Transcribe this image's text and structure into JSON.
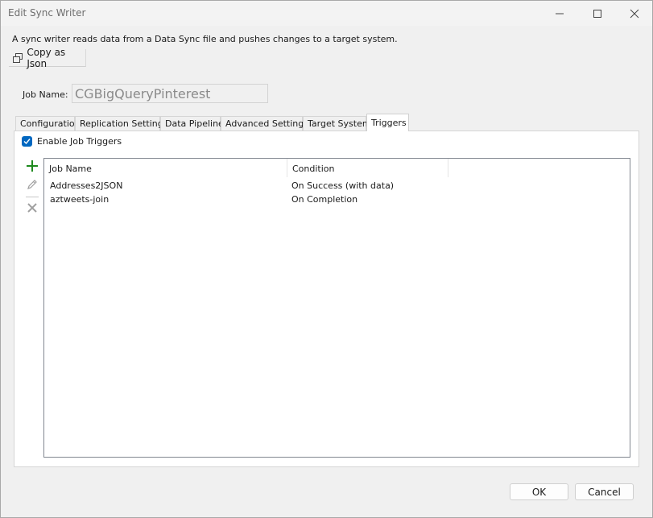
{
  "window": {
    "title": "Edit Sync Writer"
  },
  "description": "A sync writer reads data from a Data Sync file and pushes changes to a target system.",
  "copy_button": {
    "label": "Copy as Json",
    "icon": "copy-icon"
  },
  "job_name": {
    "label": "Job Name:",
    "value": "CGBigQueryPinterest"
  },
  "tabs": [
    {
      "label": "Configuration",
      "active": false
    },
    {
      "label": "Replication Settings",
      "active": false
    },
    {
      "label": "Data Pipeline",
      "active": false
    },
    {
      "label": "Advanced Settings",
      "active": false
    },
    {
      "label": "Target System",
      "active": false
    },
    {
      "label": "Triggers",
      "active": true
    }
  ],
  "triggers": {
    "enable_label": "Enable Job Triggers",
    "enabled": true,
    "toolbar": [
      "add-icon",
      "edit-icon",
      "delete-icon"
    ],
    "columns": [
      "Job Name",
      "Condition"
    ],
    "rows": [
      {
        "job": "Addresses2JSON",
        "condition": "On Success (with data)"
      },
      {
        "job": "aztweets-join",
        "condition": "On Completion"
      }
    ]
  },
  "buttons": {
    "ok": "OK",
    "cancel": "Cancel"
  },
  "colors": {
    "accent": "#0067c0",
    "add": "#1e8a1e"
  }
}
